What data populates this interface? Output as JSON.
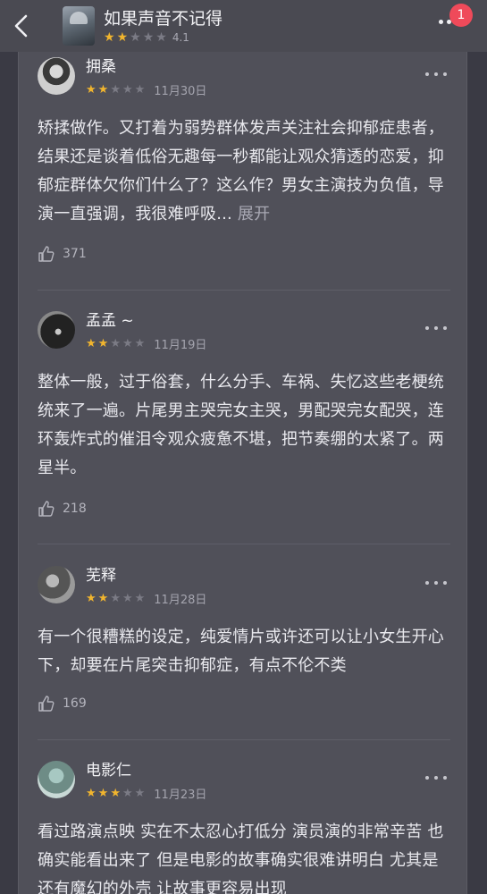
{
  "header": {
    "title": "如果声音不记得",
    "rating_stars": 2,
    "score": "4.1",
    "badge_count": "1"
  },
  "reviews": [
    {
      "username": "拥桑",
      "stars": 2,
      "date": "11月30日",
      "text": "矫揉做作。又打着为弱势群体发声关注社会抑郁症患者，结果还是谈着低俗无趣每一秒都能让观众猜透的恋爱，抑郁症群体欠你们什么了？这么作？男女主演技为负值，导演一直强调，我很难呼吸...",
      "expand_label": " 展开",
      "likes": "371"
    },
    {
      "username": "孟孟 ~",
      "stars": 2,
      "date": "11月19日",
      "text": "整体一般，过于俗套，什么分手、车祸、失忆这些老梗统统来了一遍。片尾男主哭完女主哭，男配哭完女配哭，连环轰炸式的催泪令观众疲惫不堪，把节奏绷的太紧了。两星半。",
      "likes": "218"
    },
    {
      "username": "芜释",
      "stars": 2,
      "date": "11月28日",
      "text": "有一个很糟糕的设定，纯爱情片或许还可以让小女生开心下，却要在片尾突击抑郁症，有点不伦不类",
      "likes": "169"
    },
    {
      "username": "电影仁",
      "stars": 3,
      "date": "11月23日",
      "text": "看过路演点映 实在不太忍心打低分 演员演的非常辛苦 也确实能看出来了 但是电影的故事确实很难讲明白 尤其是还有魔幻的外壳 让故事更容易出现"
    }
  ],
  "colors": {
    "star_on": "#f1b52e",
    "star_off": "#7b7b85",
    "badge": "#ef4a5a"
  }
}
